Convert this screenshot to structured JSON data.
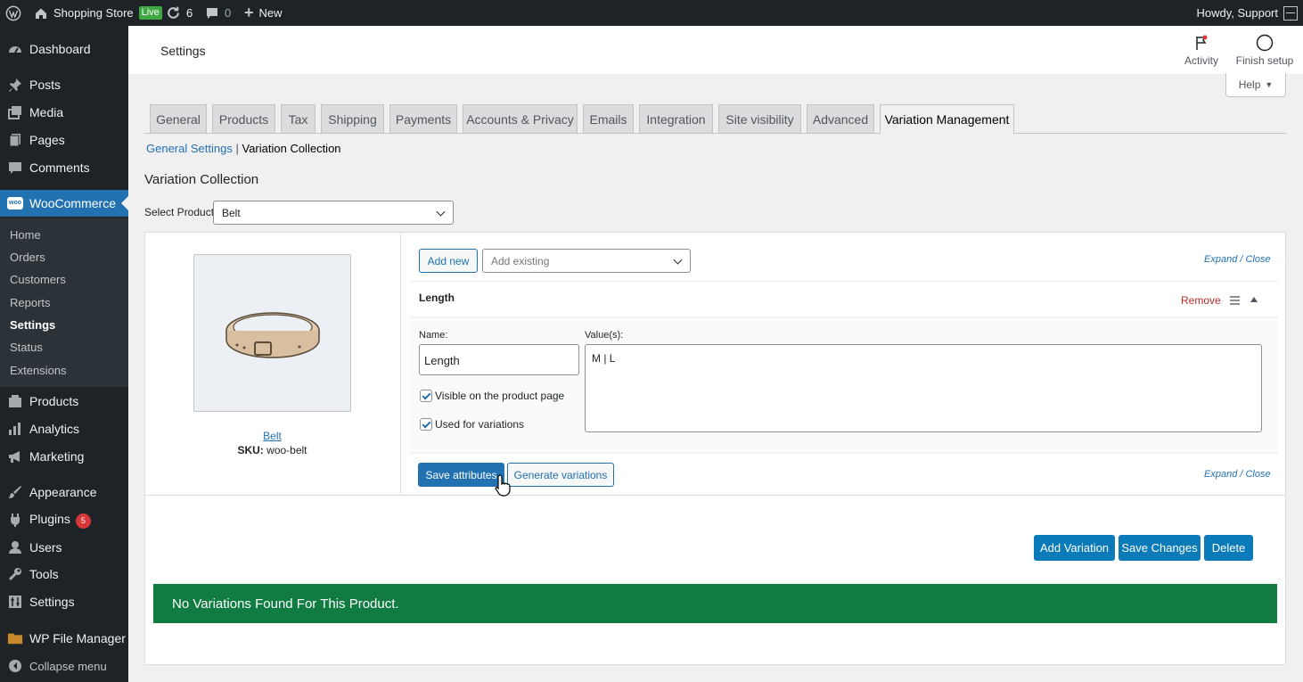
{
  "adminbar": {
    "site_name": "Shopping Store",
    "live_badge": "Live",
    "updates_count": "6",
    "comments_count": "0",
    "new_label": "New",
    "greeting": "Howdy, Support"
  },
  "sidebar": {
    "dashboard": "Dashboard",
    "posts": "Posts",
    "media": "Media",
    "pages": "Pages",
    "comments": "Comments",
    "woocommerce": "WooCommerce",
    "submenu": {
      "home": "Home",
      "orders": "Orders",
      "customers": "Customers",
      "reports": "Reports",
      "settings": "Settings",
      "status": "Status",
      "extensions": "Extensions"
    },
    "products": "Products",
    "analytics": "Analytics",
    "marketing": "Marketing",
    "appearance": "Appearance",
    "plugins": "Plugins",
    "plugins_badge": "5",
    "users": "Users",
    "tools": "Tools",
    "settings": "Settings",
    "file_manager": "WP File Manager",
    "collapse": "Collapse menu"
  },
  "header": {
    "title": "Settings",
    "activity": "Activity",
    "finish_setup": "Finish setup",
    "help": "Help"
  },
  "tabs": {
    "general": "General",
    "products": "Products",
    "tax": "Tax",
    "shipping": "Shipping",
    "payments": "Payments",
    "accounts": "Accounts & Privacy",
    "emails": "Emails",
    "integration": "Integration",
    "site_visibility": "Site visibility",
    "advanced": "Advanced",
    "variation_management": "Variation Management"
  },
  "subnav": {
    "general_settings": "General Settings",
    "separator": "|",
    "variation_collection": "Variation Collection"
  },
  "main": {
    "heading": "Variation Collection",
    "select_label": "Select Product",
    "selected_product": "Belt",
    "product_link": "Belt",
    "sku_label": "SKU:",
    "sku_value": "woo-belt",
    "add_new": "Add new",
    "add_existing_placeholder": "Add existing",
    "expand_close": "Expand / Close",
    "attribute_name_heading": "Length",
    "remove": "Remove",
    "name_label": "Name:",
    "name_value": "Length",
    "values_label": "Value(s):",
    "values_value": "M | L",
    "visible_label": "Visible on the product page",
    "used_label": "Used for variations",
    "save_attributes": "Save attributes",
    "generate_variations": "Generate variations",
    "add_variation": "Add Variation",
    "save_changes": "Save Changes",
    "delete": "Delete",
    "notice": "No Variations Found For This Product."
  },
  "colors": {
    "accent": "#2271b1",
    "admin_dark": "#1d2327",
    "notice_green": "#107c41",
    "remove_red": "#b32d2e"
  }
}
